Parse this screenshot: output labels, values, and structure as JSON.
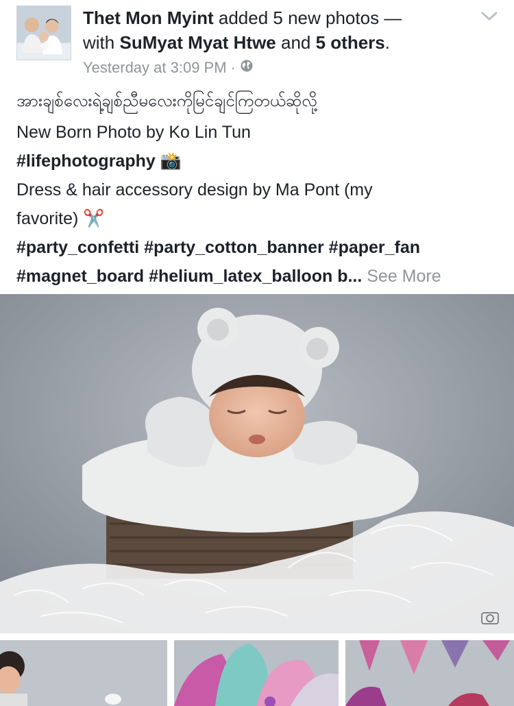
{
  "post": {
    "author": "Thet Mon Myint",
    "action": "added 5 new photos —",
    "with_prefix": "with",
    "tagged_person": "SuMyat Myat Htwe",
    "and_word": "and",
    "others": "5 others",
    "period": ".",
    "timestamp": "Yesterday at 3:09 PM",
    "separator": "·",
    "privacy_icon": "globe-icon",
    "menu_icon": "chevron-down-icon"
  },
  "caption": {
    "burmese_line": "အားချစ်လေးရဲ့ချစ်ညီမလေးကိုမြင်ချင်ကြတယ်ဆိုလို့",
    "line2": "New Born Photo by Ko Lin Tun",
    "hashtag1": "#lifephotography",
    "camera_emoji": "📸",
    "line4a": "Dress & hair accessory design by Ma Pont (my",
    "line4b": "favorite)",
    "scissors_emoji": "✂️",
    "hashtags_line1": "#party_confetti #party_cotton_banner #paper_fan",
    "hashtags_line2": "#magnet_board #helium_latex_balloon b...",
    "see_more": "See More"
  },
  "photos": {
    "count_added": 5,
    "main": {
      "description": ""
    },
    "thumbnails": [
      "thumb-1",
      "thumb-2",
      "thumb-3"
    ]
  },
  "colors": {
    "text_primary": "#1d2129",
    "text_secondary": "#90949c",
    "background": "#ffffff"
  }
}
